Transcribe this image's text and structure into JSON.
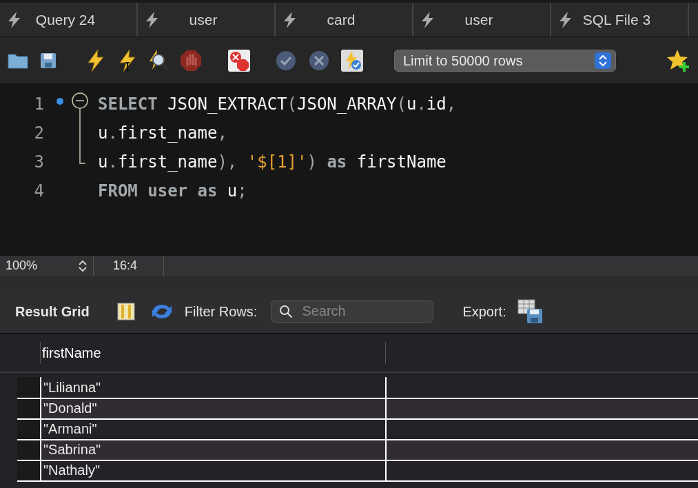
{
  "tabs": [
    {
      "label": "Query 24"
    },
    {
      "label": "user"
    },
    {
      "label": "card"
    },
    {
      "label": "user"
    },
    {
      "label": "SQL File 3"
    }
  ],
  "toolbar": {
    "limit_select": "Limit to 50000 rows"
  },
  "editor": {
    "lines": [
      {
        "number": "1",
        "tokens": [
          {
            "text": "SELECT ",
            "kind": "keyword"
          },
          {
            "text": "JSON_EXTRACT",
            "kind": "ident"
          },
          {
            "text": "(",
            "kind": "punct"
          },
          {
            "text": "JSON_ARRAY",
            "kind": "ident"
          },
          {
            "text": "(",
            "kind": "punct"
          },
          {
            "text": "u",
            "kind": "ident"
          },
          {
            "text": ".",
            "kind": "punct"
          },
          {
            "text": "id",
            "kind": "ident"
          },
          {
            "text": ",",
            "kind": "punct"
          }
        ]
      },
      {
        "number": "2",
        "tokens": [
          {
            "text": "u",
            "kind": "ident"
          },
          {
            "text": ".",
            "kind": "punct"
          },
          {
            "text": "first_name",
            "kind": "ident"
          },
          {
            "text": ",",
            "kind": "punct"
          }
        ]
      },
      {
        "number": "3",
        "tokens": [
          {
            "text": "u",
            "kind": "ident"
          },
          {
            "text": ".",
            "kind": "punct"
          },
          {
            "text": "first_name",
            "kind": "ident"
          },
          {
            "text": "), ",
            "kind": "punct"
          },
          {
            "text": "'$[1]'",
            "kind": "string"
          },
          {
            "text": ") ",
            "kind": "punct"
          },
          {
            "text": "as ",
            "kind": "keyword"
          },
          {
            "text": "firstName",
            "kind": "ident"
          }
        ]
      },
      {
        "number": "4",
        "tokens": [
          {
            "text": "FROM user as ",
            "kind": "keyword"
          },
          {
            "text": "u",
            "kind": "ident"
          },
          {
            "text": ";",
            "kind": "punct"
          }
        ]
      }
    ]
  },
  "status_bar": {
    "zoom": "100%",
    "cursor": "16:4"
  },
  "result_toolbar": {
    "title": "Result Grid",
    "filter_label": "Filter Rows:",
    "search_placeholder": "Search",
    "export_label": "Export:"
  },
  "table": {
    "columns": [
      "firstName"
    ],
    "rows": [
      "\"Lilianna\"",
      "\"Donald\"",
      "\"Armani\"",
      "\"Sabrina\"",
      "\"Nathaly\""
    ]
  }
}
